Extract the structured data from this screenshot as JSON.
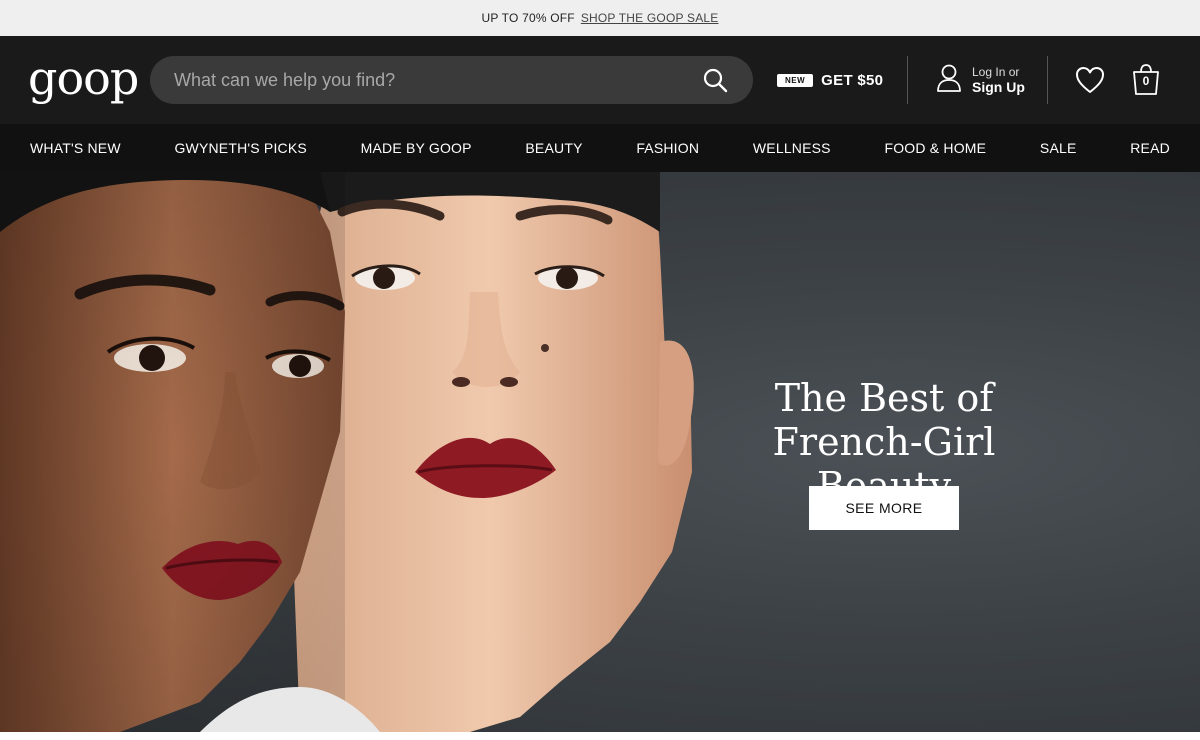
{
  "promo": {
    "text": "UP TO 70% OFF",
    "link": "SHOP THE GOOP SALE"
  },
  "header": {
    "logo": "goop",
    "search_placeholder": "What can we help you find?",
    "new_badge": "NEW",
    "get50_label": "GET $50",
    "account_small": "Log In or",
    "account_big": "Sign Up",
    "cart_count": "0",
    "icons": [
      "search-icon",
      "user-icon",
      "heart-icon",
      "shopping-bag-icon"
    ]
  },
  "nav": {
    "items": [
      "WHAT'S NEW",
      "GWYNETH'S PICKS",
      "MADE BY GOOP",
      "BEAUTY",
      "FASHION",
      "WELLNESS",
      "FOOD & HOME",
      "SALE",
      "READ"
    ]
  },
  "hero": {
    "headline_line1": "The Best of",
    "headline_line2": "French-Girl Beauty",
    "button_label": "SEE MORE"
  },
  "colors": {
    "header_bg": "#1a1a1a",
    "nav_bg": "#111111",
    "promo_bg": "#efefef",
    "hero_bg": "#3c4145",
    "lip_red": "#8e1a24"
  }
}
